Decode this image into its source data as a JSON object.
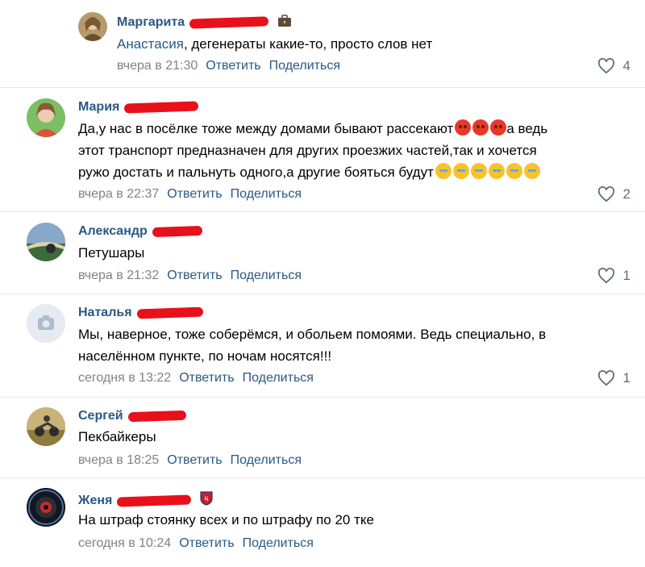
{
  "colors": {
    "link": "#2a5885",
    "meta": "#828282",
    "redaction": "#e8101a",
    "divider": "#e7e8ec"
  },
  "comments": [
    {
      "author": "Маргарита",
      "text_mention": "Анастасия",
      "text": ", дегенераты какие-то, просто слов нет",
      "date": "вчера в 21:30",
      "reply": "Ответить",
      "share": "Поделиться",
      "likes": "4",
      "badge_icon": "briefcase-icon"
    },
    {
      "author": "Мария",
      "text_lines": [
        "Да,у нас в посёлке тоже между домами бывают рассекают",
        "а ведь",
        "этот транспорт предназначен для других проезжих частей,так и хочется",
        "ружо достать и пальнуть одного,а другие бояться будут"
      ],
      "date": "вчера в 22:37",
      "reply": "Ответить",
      "share": "Поделиться",
      "likes": "2"
    },
    {
      "author": "Александр",
      "text": "Петушары",
      "date": "вчера в 21:32",
      "reply": "Ответить",
      "share": "Поделиться",
      "likes": "1"
    },
    {
      "author": "Наталья",
      "text_lines": [
        "Мы, наверное, тоже соберёмся, и обольем помоями. Ведь специально, в",
        "населённом пункте, по ночам носятся!!!"
      ],
      "date": "сегодня в 13:22",
      "reply": "Ответить",
      "share": "Поделиться",
      "likes": "1"
    },
    {
      "author": "Сергей",
      "text": "Пекбайкеры",
      "date": "вчера в 18:25",
      "reply": "Ответить",
      "share": "Поделиться"
    },
    {
      "author": "Женя",
      "text": "На штраф стоянку всех и по штрафу по 20 тке",
      "date": "сегодня в 10:24",
      "reply": "Ответить",
      "share": "Поделиться",
      "badge_icon": "club-crest-icon"
    }
  ]
}
